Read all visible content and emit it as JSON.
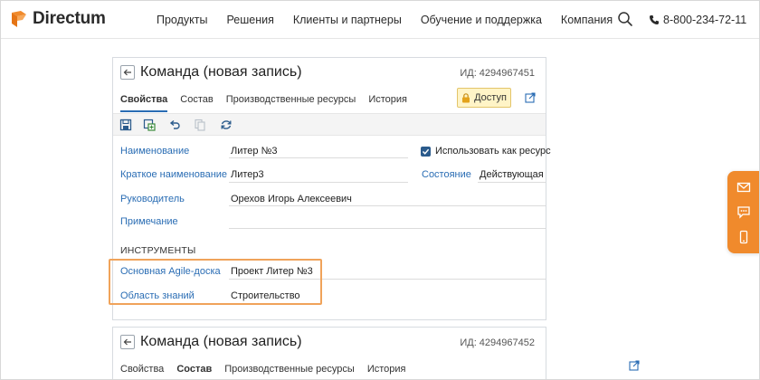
{
  "header": {
    "logo_text": "Directum",
    "nav": [
      "Продукты",
      "Решения",
      "Клиенты и партнеры",
      "Обучение и поддержка",
      "Компания"
    ],
    "phone": "8-800-234-72-11"
  },
  "card1": {
    "title": "Команда (новая запись)",
    "id": "ИД: 4294967451",
    "tabs": [
      "Свойства",
      "Состав",
      "Производственные ресурсы",
      "История"
    ],
    "active_tab": "Свойства",
    "access_label": "Доступ",
    "fields": {
      "name_label": "Наименование",
      "name_value": "Литер №3",
      "short_label": "Краткое наименование",
      "short_value": "Литер3",
      "lead_label": "Руководитель",
      "lead_value": "Орехов Игорь Алексеевич",
      "note_label": "Примечание",
      "note_value": "",
      "use_resource_label": "Использовать как ресурс",
      "use_resource_checked": true,
      "state_label": "Состояние",
      "state_value": "Действующая"
    },
    "tools_section": "ИНСТРУМЕНТЫ",
    "tools": {
      "agile_label": "Основная Agile-доска",
      "agile_value": "Проект Литер №3",
      "knowledge_label": "Область знаний",
      "knowledge_value": "Строительство"
    }
  },
  "card2": {
    "title": "Команда (новая запись)",
    "id": "ИД: 4294967452",
    "tabs": [
      "Свойства",
      "Состав",
      "Производственные ресурсы",
      "История"
    ],
    "active_tab": "Состав"
  },
  "colors": {
    "brand_orange": "#f08a2c",
    "link_blue": "#2a6db4",
    "highlight": "#f0a35a",
    "access_bg": "#fff4c7"
  }
}
